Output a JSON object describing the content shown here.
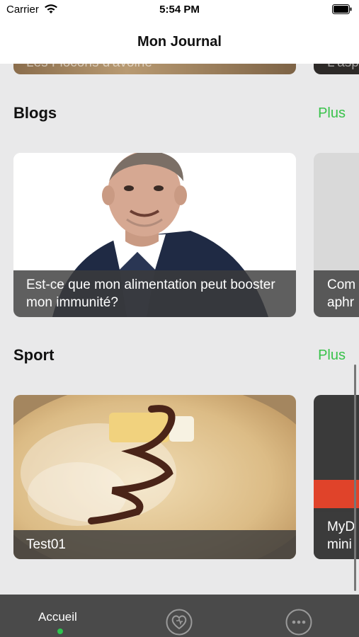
{
  "status_bar": {
    "carrier": "Carrier",
    "time": "5:54 PM",
    "wifi_icon": "wifi-icon",
    "battery_icon": "battery-icon"
  },
  "nav": {
    "title": "Mon Journal"
  },
  "top_partial": {
    "left_caption_fragment": "Les Flocons d'avoine",
    "right_caption_fragment": "L'asp"
  },
  "sections": [
    {
      "title": "Blogs",
      "more_label": "Plus",
      "cards": [
        {
          "caption": "Est-ce que mon alimentation peut booster mon immunité?",
          "image": "portrait of smiling man"
        },
        {
          "caption": "Com aphr",
          "image": "partially visible card"
        }
      ]
    },
    {
      "title": "Sport",
      "more_label": "Plus",
      "cards": [
        {
          "caption": "Test01",
          "image": "crepe with sugar and chocolate"
        },
        {
          "caption": "MyD mini",
          "image": "partially visible card"
        }
      ]
    }
  ],
  "tab_bar": {
    "items": [
      {
        "label": "Accueil",
        "icon": "home-label",
        "active": true
      },
      {
        "label": "",
        "icon": "heart-icon"
      },
      {
        "label": "",
        "icon": "more-icon"
      }
    ],
    "active_color": "#2ec44f"
  },
  "colors": {
    "accent": "#38c24a",
    "background": "#e9e9ea",
    "tabbar": "#4a4a4a"
  }
}
